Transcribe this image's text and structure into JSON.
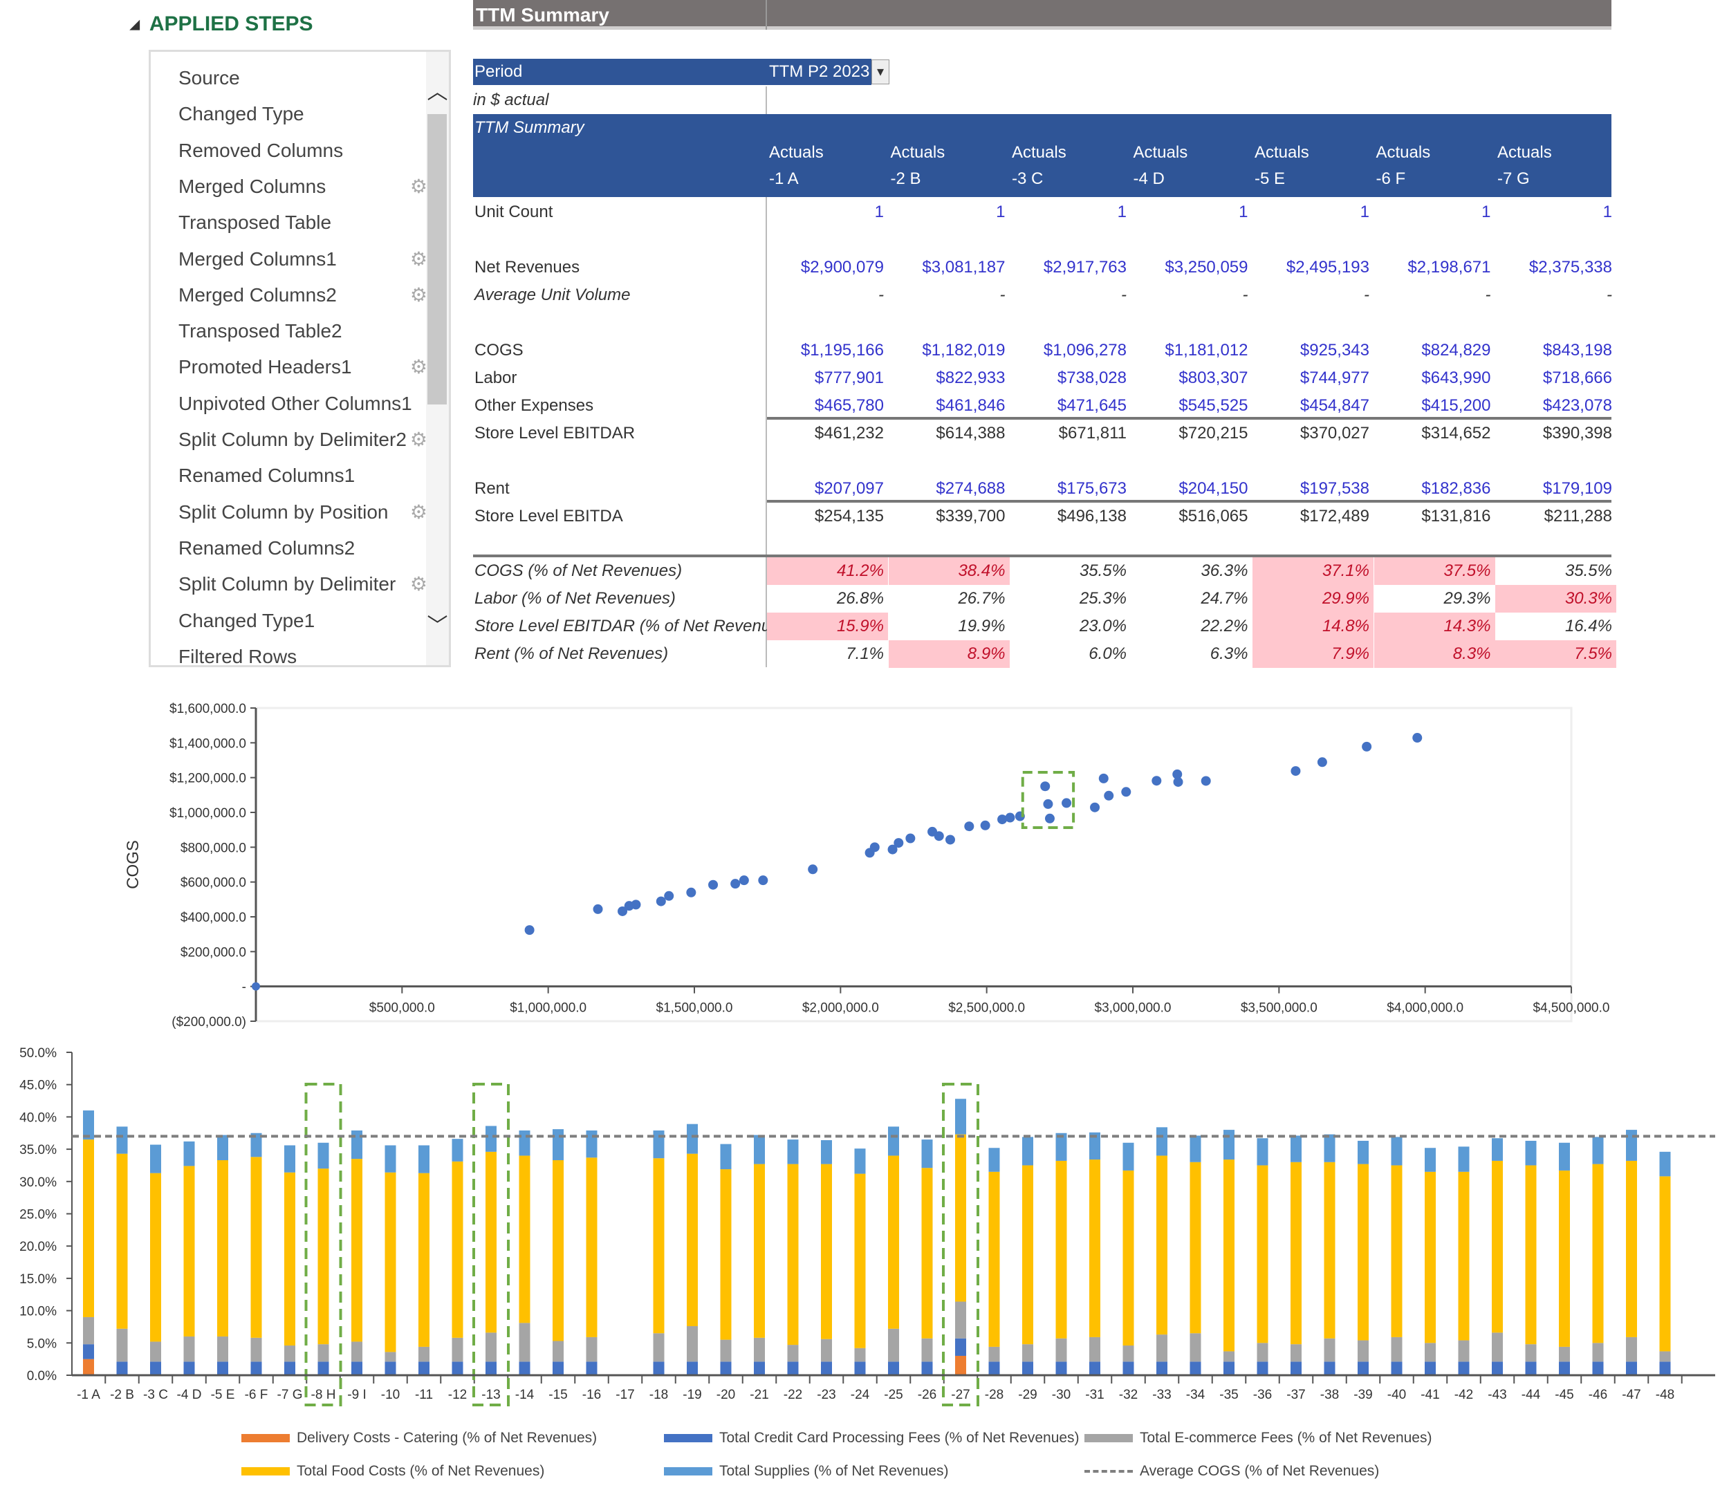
{
  "applied_steps": {
    "title": "APPLIED STEPS",
    "items": [
      {
        "label": "Source",
        "gear": false
      },
      {
        "label": "Changed Type",
        "gear": false
      },
      {
        "label": "Removed Columns",
        "gear": false
      },
      {
        "label": "Merged Columns",
        "gear": true
      },
      {
        "label": "Transposed Table",
        "gear": false
      },
      {
        "label": "Merged Columns1",
        "gear": true
      },
      {
        "label": "Merged Columns2",
        "gear": true
      },
      {
        "label": "Transposed Table2",
        "gear": false
      },
      {
        "label": "Promoted Headers1",
        "gear": true
      },
      {
        "label": "Unpivoted Other Columns1",
        "gear": false
      },
      {
        "label": "Split Column by Delimiter2",
        "gear": true
      },
      {
        "label": "Renamed Columns1",
        "gear": false
      },
      {
        "label": "Split Column by Position",
        "gear": true
      },
      {
        "label": "Renamed Columns2",
        "gear": false
      },
      {
        "label": "Split Column by Delimiter",
        "gear": true
      },
      {
        "label": "Changed Type1",
        "gear": false
      },
      {
        "label": "Filtered Rows",
        "gear": false
      }
    ]
  },
  "summary": {
    "title": "TTM Summary",
    "period_label": "Period",
    "period_value": "TTM P2 2023",
    "unit_note": "in $ actual",
    "section_label": "TTM Summary",
    "columns": [
      {
        "type": "Actuals",
        "name": "-1 A"
      },
      {
        "type": "Actuals",
        "name": "-2 B"
      },
      {
        "type": "Actuals",
        "name": "-3 C"
      },
      {
        "type": "Actuals",
        "name": "-4 D"
      },
      {
        "type": "Actuals",
        "name": "-5 E"
      },
      {
        "type": "Actuals",
        "name": "-6 F"
      },
      {
        "type": "Actuals",
        "name": "-7 G"
      }
    ],
    "rows": [
      {
        "label": "Unit Count",
        "values": [
          "1",
          "1",
          "1",
          "1",
          "1",
          "1",
          "1"
        ],
        "input": true
      },
      {
        "label": "Net Revenues",
        "values": [
          "$2,900,079",
          "$3,081,187",
          "$2,917,763",
          "$3,250,059",
          "$2,495,193",
          "$2,198,671",
          "$2,375,338"
        ],
        "input": true
      },
      {
        "label": "Average Unit Volume",
        "italic": true,
        "values": [
          "-",
          "-",
          "-",
          "-",
          "-",
          "-",
          "-"
        ]
      },
      {
        "label": "COGS",
        "values": [
          "$1,195,166",
          "$1,182,019",
          "$1,096,278",
          "$1,181,012",
          "$925,343",
          "$824,829",
          "$843,198"
        ],
        "input": true
      },
      {
        "label": "Labor",
        "values": [
          "$777,901",
          "$822,933",
          "$738,028",
          "$803,307",
          "$744,977",
          "$643,990",
          "$718,666"
        ],
        "input": true
      },
      {
        "label": "Other Expenses",
        "values": [
          "$465,780",
          "$461,846",
          "$471,645",
          "$545,525",
          "$454,847",
          "$415,200",
          "$423,078"
        ],
        "input": true
      },
      {
        "label": "Store Level EBITDAR",
        "values": [
          "$461,232",
          "$614,388",
          "$671,811",
          "$720,215",
          "$370,027",
          "$314,652",
          "$390,398"
        ]
      },
      {
        "label": "Rent",
        "values": [
          "$207,097",
          "$274,688",
          "$175,673",
          "$204,150",
          "$197,538",
          "$182,836",
          "$179,109"
        ],
        "input": true
      },
      {
        "label": "Store Level EBITDA",
        "values": [
          "$254,135",
          "$339,700",
          "$496,138",
          "$516,065",
          "$172,489",
          "$131,816",
          "$211,288"
        ]
      },
      {
        "label": "COGS (% of Net Revenues)",
        "italic": true,
        "values": [
          "41.2%",
          "38.4%",
          "35.5%",
          "36.3%",
          "37.1%",
          "37.5%",
          "35.5%"
        ],
        "flagged": [
          true,
          true,
          false,
          false,
          true,
          true,
          false
        ]
      },
      {
        "label": "Labor (% of Net Revenues)",
        "italic": true,
        "values": [
          "26.8%",
          "26.7%",
          "25.3%",
          "24.7%",
          "29.9%",
          "29.3%",
          "30.3%"
        ],
        "flagged": [
          false,
          false,
          false,
          false,
          true,
          false,
          true
        ]
      },
      {
        "label": "Store Level EBITDAR (% of Net Revenues)",
        "italic": true,
        "values": [
          "15.9%",
          "19.9%",
          "23.0%",
          "22.2%",
          "14.8%",
          "14.3%",
          "16.4%"
        ],
        "flagged": [
          true,
          false,
          false,
          false,
          true,
          true,
          false
        ]
      },
      {
        "label": "Rent (% of Net Revenues)",
        "italic": true,
        "values": [
          "7.1%",
          "8.9%",
          "6.0%",
          "6.3%",
          "7.9%",
          "8.3%",
          "7.5%"
        ],
        "flagged": [
          false,
          true,
          false,
          false,
          true,
          true,
          true
        ]
      }
    ]
  },
  "colors": {
    "header_blue": "#2f5597",
    "title_grey": "#767171",
    "input_blue": "#3333cc",
    "flag_fill": "#ffc7ce",
    "flag_text": "#c0102a",
    "point": "#4472c4",
    "highlight_box": "#70ad47"
  },
  "chart_data": [
    {
      "type": "scatter",
      "title": "",
      "xlabel": "",
      "ylabel": "COGS",
      "xlim": [
        0,
        4500000
      ],
      "ylim": [
        -200000,
        1600000
      ],
      "x_ticks": [
        "$500,000.0",
        "$1,000,000.0",
        "$1,500,000.0",
        "$2,000,000.0",
        "$2,500,000.0",
        "$3,000,000.0",
        "$3,500,000.0",
        "$4,000,000.0",
        "$4,500,000.0"
      ],
      "y_ticks": [
        "($200,000.0)",
        "-",
        "$200,000.0",
        "$400,000.0",
        "$600,000.0",
        "$800,000.0",
        "$1,000,000.0",
        "$1,200,000.0",
        "$1,400,000.0",
        "$1,600,000.0"
      ],
      "highlighted_x_range": [
        2680000,
        2740000
      ],
      "points": [
        [
          0,
          0
        ],
        [
          936000,
          324000
        ],
        [
          1170000,
          444000
        ],
        [
          1254000,
          432000
        ],
        [
          1277000,
          463000
        ],
        [
          1300000,
          470000
        ],
        [
          1386000,
          489000
        ],
        [
          1413000,
          520000
        ],
        [
          1489000,
          540000
        ],
        [
          1564000,
          584000
        ],
        [
          1640000,
          590000
        ],
        [
          1670000,
          610000
        ],
        [
          1735000,
          610000
        ],
        [
          1905000,
          673000
        ],
        [
          2100000,
          768000
        ],
        [
          2117000,
          800000
        ],
        [
          2178000,
          787000
        ],
        [
          2198671,
          824829
        ],
        [
          2239000,
          851000
        ],
        [
          2314000,
          889000
        ],
        [
          2337000,
          864000
        ],
        [
          2375338,
          843198
        ],
        [
          2440000,
          920000
        ],
        [
          2495193,
          925343
        ],
        [
          2553000,
          960000
        ],
        [
          2580000,
          970000
        ],
        [
          2614000,
          978000
        ],
        [
          2700000,
          1150000
        ],
        [
          2710000,
          1048000
        ],
        [
          2716000,
          965000
        ],
        [
          2773000,
          1054000
        ],
        [
          2870000,
          1029000
        ],
        [
          2900079,
          1195166
        ],
        [
          2917763,
          1096278
        ],
        [
          2977000,
          1118000
        ],
        [
          3081187,
          1182019
        ],
        [
          3152000,
          1219000
        ],
        [
          3155000,
          1175000
        ],
        [
          3250059,
          1181012
        ],
        [
          3557000,
          1238000
        ],
        [
          3648000,
          1289000
        ],
        [
          3800000,
          1378000
        ],
        [
          3973000,
          1429000
        ]
      ]
    },
    {
      "type": "bar",
      "stacked": true,
      "title": "",
      "ylim": [
        0,
        50
      ],
      "y_ticks": [
        "0.0%",
        "5.0%",
        "10.0%",
        "15.0%",
        "20.0%",
        "25.0%",
        "30.0%",
        "35.0%",
        "40.0%",
        "45.0%",
        "50.0%"
      ],
      "legend_position": "bottom",
      "categories": [
        "-1 A",
        "-2 B",
        "-3 C",
        "-4 D",
        "-5 E",
        "-6 F",
        "-7 G",
        "-8 H",
        "-9 I",
        "-10",
        "-11",
        "-12",
        "-13",
        "-14",
        "-15",
        "-16",
        "-17",
        "-18",
        "-19",
        "-20",
        "-21",
        "-22",
        "-23",
        "-24",
        "-25",
        "-26",
        "-27",
        "-28",
        "-29",
        "-30",
        "-31",
        "-32",
        "-33",
        "-34",
        "-35",
        "-36",
        "-37",
        "-38",
        "-39",
        "-40",
        "-41",
        "-42",
        "-43",
        "-44",
        "-45",
        "-46",
        "-47",
        "-48"
      ],
      "highlighted_categories": [
        "-8 H",
        "-13",
        "-27"
      ],
      "series": [
        {
          "name": "Delivery Costs - Catering (% of Net Revenues)",
          "color": "#ed7d31",
          "values": [
            2.5,
            0,
            0,
            0,
            0,
            0,
            0,
            0,
            0,
            0,
            0,
            0,
            0,
            0,
            0,
            0,
            0,
            0,
            0,
            0,
            0,
            0,
            0,
            0,
            0,
            0,
            3.0,
            0,
            0,
            0,
            0,
            0,
            0,
            0,
            0,
            0,
            0,
            0,
            0,
            0,
            0,
            0,
            0,
            0,
            0,
            0,
            0,
            0
          ]
        },
        {
          "name": "Total Credit Card Processing Fees (% of Net Revenues)",
          "color": "#4472c4",
          "values": [
            2.3,
            2.1,
            2.1,
            2.1,
            2.1,
            2.1,
            2.1,
            2.1,
            2.1,
            2.1,
            2.1,
            2.1,
            2.1,
            2.1,
            2.1,
            2.1,
            0,
            2.1,
            2.1,
            2.1,
            2.1,
            2.1,
            2.1,
            2.1,
            2.1,
            2.1,
            2.7,
            2.1,
            2.1,
            2.1,
            2.1,
            2.1,
            2.1,
            2.1,
            2.1,
            2.1,
            2.1,
            2.1,
            2.1,
            2.1,
            2.1,
            2.1,
            2.1,
            2.1,
            2.1,
            2.1,
            2.1,
            2.1
          ]
        },
        {
          "name": "Total E-commerce Fees (% of Net Revenues)",
          "color": "#a5a5a5",
          "values": [
            4.2,
            5.1,
            3.1,
            3.9,
            3.9,
            3.7,
            2.5,
            2.7,
            3.1,
            1.5,
            2.3,
            3.7,
            4.5,
            6.0,
            3.2,
            3.8,
            0,
            4.4,
            5.5,
            3.4,
            3.7,
            2.6,
            3.5,
            2.1,
            5.1,
            3.6,
            5.7,
            2.3,
            2.7,
            3.6,
            3.8,
            2.5,
            4.2,
            4.4,
            1.6,
            2.9,
            2.7,
            3.6,
            3.3,
            3.8,
            2.9,
            3.3,
            4.5,
            2.7,
            2.3,
            2.9,
            3.8,
            1.6
          ]
        },
        {
          "name": "Total Food Costs (% of Net Revenues)",
          "color": "#ffc000",
          "values": [
            27.5,
            27.1,
            26.1,
            26.4,
            27.3,
            28.0,
            26.8,
            27.2,
            28.3,
            27.8,
            26.9,
            27.3,
            28.0,
            25.9,
            28.0,
            27.8,
            0,
            27.1,
            26.7,
            26.4,
            26.9,
            28.0,
            27.1,
            27.0,
            26.8,
            26.4,
            25.9,
            27.1,
            27.7,
            27.5,
            27.5,
            27.1,
            27.7,
            26.5,
            29.7,
            27.5,
            28.2,
            27.3,
            27.3,
            26.6,
            26.5,
            26.1,
            26.6,
            27.7,
            27.3,
            27.7,
            27.3,
            27.1
          ]
        },
        {
          "name": "Total Supplies (% of Net Revenues)",
          "color": "#5b9bd5",
          "values": [
            4.5,
            4.2,
            4.4,
            3.8,
            3.9,
            3.7,
            4.2,
            4.0,
            4.4,
            4.2,
            4.3,
            3.5,
            4.0,
            3.9,
            4.8,
            4.2,
            0,
            4.3,
            4.6,
            3.9,
            4.5,
            3.8,
            3.7,
            3.9,
            4.5,
            4.4,
            5.5,
            3.7,
            4.4,
            4.3,
            4.2,
            4.3,
            4.4,
            4.1,
            4.6,
            4.2,
            4.1,
            4.3,
            3.6,
            4.4,
            3.7,
            3.9,
            3.5,
            3.8,
            4.3,
            4.2,
            4.8,
            3.8
          ]
        }
      ],
      "average_line": {
        "name": "Average COGS (% of Net Revenues)",
        "value": 37.0,
        "color": "#7f7f7f"
      }
    }
  ]
}
